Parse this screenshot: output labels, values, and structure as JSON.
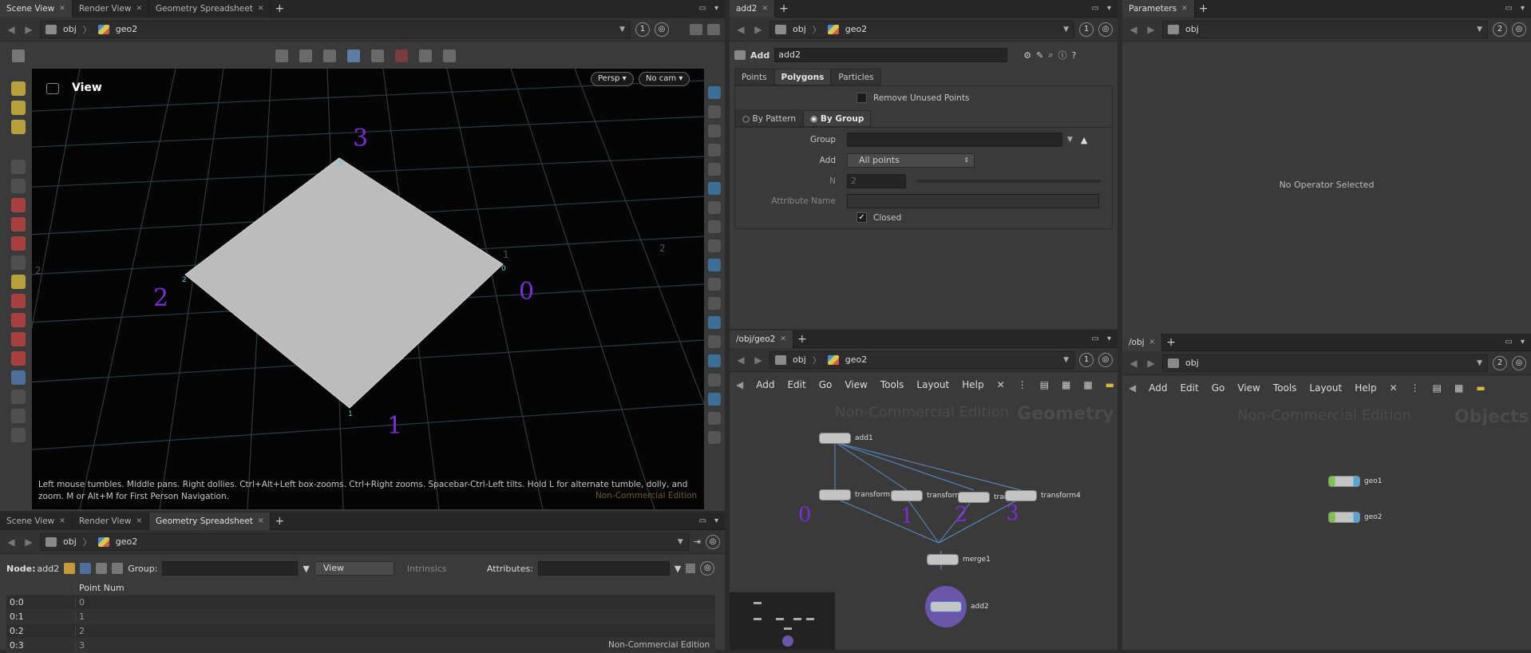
{
  "top_left": {
    "tabs": [
      "Scene View",
      "Render View",
      "Geometry Spreadsheet"
    ],
    "path": {
      "a": "obj",
      "b": "geo2",
      "count": "1"
    },
    "viewport": {
      "label": "View",
      "persp": "Persp ▾",
      "cam": "No cam ▾",
      "help": "Left mouse tumbles. Middle pans. Right dollies. Ctrl+Alt+Left box-zooms. Ctrl+Right zooms. Spacebar-Ctrl-Left tilts. Hold L for alternate tumble, dolly, and zoom. M or Alt+M for First Person Navigation.",
      "watermark": "Non-Commercial Edition",
      "pt_labels": {
        "p3": "3",
        "p2": "2",
        "p1": "1",
        "p0": "0"
      },
      "ann": {
        "a3": "3",
        "a2": "2",
        "a1": "1",
        "a0": "0"
      },
      "grid_nums": {
        "g1": "2",
        "g2": "2",
        "g3": "1"
      }
    }
  },
  "bottom_left": {
    "tabs": [
      "Scene View",
      "Render View",
      "Geometry Spreadsheet"
    ],
    "path": {
      "a": "obj",
      "b": "geo2"
    },
    "node_label": "Node:",
    "node": "add2",
    "group_label": "Group:",
    "view_label": "View",
    "intrinsics": "Intrinsics",
    "attributes_label": "Attributes:",
    "header": "Point Num",
    "rows": [
      {
        "id": "0:0",
        "v": "0"
      },
      {
        "id": "0:1",
        "v": "1"
      },
      {
        "id": "0:2",
        "v": "2"
      },
      {
        "id": "0:3",
        "v": "3"
      }
    ],
    "watermark": "Non-Commercial Edition"
  },
  "params": {
    "tab": "add2",
    "path": {
      "a": "obj",
      "b": "geo2",
      "count": "1"
    },
    "type": "Add",
    "name": "add2",
    "subtabs": [
      "Points",
      "Polygons",
      "Particles"
    ],
    "remove_unused": "Remove Unused Points",
    "by_pattern": "By Pattern",
    "by_group": "By Group",
    "group_label": "Group",
    "add_label": "Add",
    "add_value": "All points",
    "n_label": "N",
    "n_value": "2",
    "attr_label": "Attribute Name",
    "closed_label": "Closed"
  },
  "network": {
    "tab": "/obj/geo2",
    "path": {
      "a": "obj",
      "b": "geo2",
      "count": "1"
    },
    "menu": [
      "Add",
      "Edit",
      "Go",
      "View",
      "Tools",
      "Layout",
      "Help"
    ],
    "nce": "Non-Commercial Edition",
    "context": "Geometry",
    "nodes": {
      "add1": "add1",
      "t1": "transform1",
      "t2": "transform2",
      "t3": "transform3",
      "t4": "transform4",
      "merge": "merge1",
      "add2": "add2"
    },
    "ann": {
      "a0": "0",
      "a1": "1",
      "a2": "2",
      "a3": "3"
    }
  },
  "right_params": {
    "tab": "Parameters",
    "path": "obj",
    "count": "2",
    "empty": "No Operator Selected"
  },
  "obj_net": {
    "tab": "/obj",
    "path": "obj",
    "count": "2",
    "menu": [
      "Add",
      "Edit",
      "Go",
      "View",
      "Tools",
      "Layout",
      "Help"
    ],
    "nce": "Non-Commercial Edition",
    "context": "Objects",
    "nodes": {
      "geo1": "geo1",
      "geo2": "geo2"
    }
  }
}
